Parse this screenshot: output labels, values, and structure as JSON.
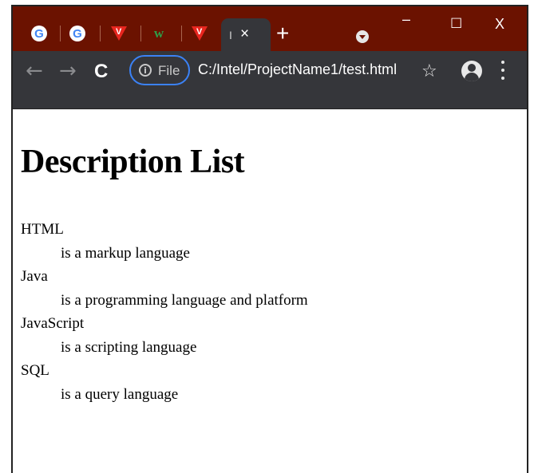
{
  "browser": {
    "tabs": [
      {
        "icon": "google-icon",
        "glyph": "G"
      },
      {
        "icon": "google-icon",
        "glyph": "G"
      },
      {
        "icon": "vivaldi-icon",
        "glyph": "V"
      },
      {
        "icon": "w-logo-icon",
        "glyph": "w"
      },
      {
        "icon": "vivaldi-icon",
        "glyph": "V"
      }
    ],
    "active_tab": {
      "favicon": "I",
      "close": "×"
    },
    "new_tab": "+",
    "window_controls": {
      "minimize": "–",
      "maximize": "☐",
      "close": "X"
    },
    "toolbar": {
      "back": "←",
      "forward": "→",
      "reload": "C",
      "bookmark": "☆"
    },
    "address": {
      "info_icon": "i",
      "chip_label": "File",
      "url": "C:/Intel/ProjectName1/test.html"
    },
    "colors": {
      "tab_bar": "#6b1200",
      "toolbar": "#35363a",
      "focus_ring": "#3b82f6"
    }
  },
  "page": {
    "heading": "Description List",
    "items": [
      {
        "term": "HTML",
        "description": "is a markup language"
      },
      {
        "term": "Java",
        "description": "is a programming language and platform"
      },
      {
        "term": "JavaScript",
        "description": "is a scripting language"
      },
      {
        "term": "SQL",
        "description": "is a query language"
      }
    ]
  }
}
